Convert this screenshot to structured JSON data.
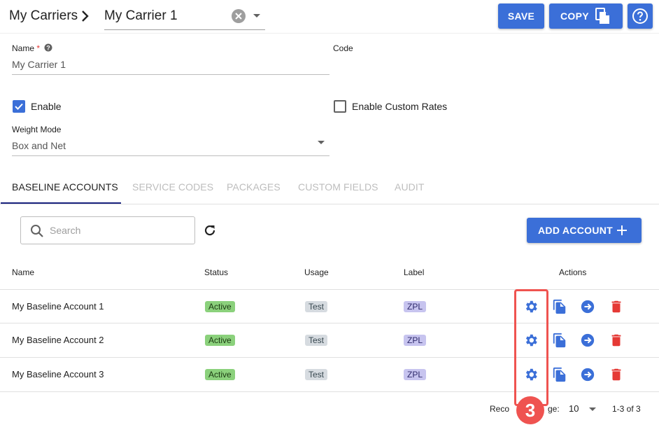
{
  "header": {
    "breadcrumb_root": "My Carriers",
    "carrier_value": "My Carrier 1",
    "save_label": "SAVE",
    "copy_label": "COPY"
  },
  "form": {
    "name_label": "Name",
    "name_required": "*",
    "name_value": "My Carrier 1",
    "code_label": "Code",
    "enable_label": "Enable",
    "enable_checked": true,
    "custom_rates_label": "Enable Custom Rates",
    "custom_rates_checked": false,
    "weight_mode_label": "Weight Mode",
    "weight_mode_value": "Box and Net"
  },
  "tabs": [
    {
      "label": "BASELINE ACCOUNTS",
      "active": true
    },
    {
      "label": "SERVICE CODES",
      "active": false
    },
    {
      "label": "PACKAGES",
      "active": false
    },
    {
      "label": "CUSTOM FIELDS",
      "active": false
    },
    {
      "label": "AUDIT",
      "active": false
    }
  ],
  "toolbar": {
    "search_placeholder": "Search",
    "add_account_label": "ADD ACCOUNT"
  },
  "table": {
    "columns": [
      "Name",
      "Status",
      "Usage",
      "Label",
      "Actions"
    ],
    "rows": [
      {
        "name": "My Baseline Account 1",
        "status": "Active",
        "usage": "Test",
        "label": "ZPL"
      },
      {
        "name": "My Baseline Account 2",
        "status": "Active",
        "usage": "Test",
        "label": "ZPL"
      },
      {
        "name": "My Baseline Account 3",
        "status": "Active",
        "usage": "Test",
        "label": "ZPL"
      }
    ]
  },
  "footer": {
    "records_label_left": "Reco",
    "records_label_right": "ge:",
    "page_size": "10",
    "range": "1-3 of 3"
  },
  "annotation": {
    "marker": "3"
  },
  "colors": {
    "primary": "#3b6fd8",
    "danger": "#e53935",
    "highlight": "#ef5350"
  }
}
